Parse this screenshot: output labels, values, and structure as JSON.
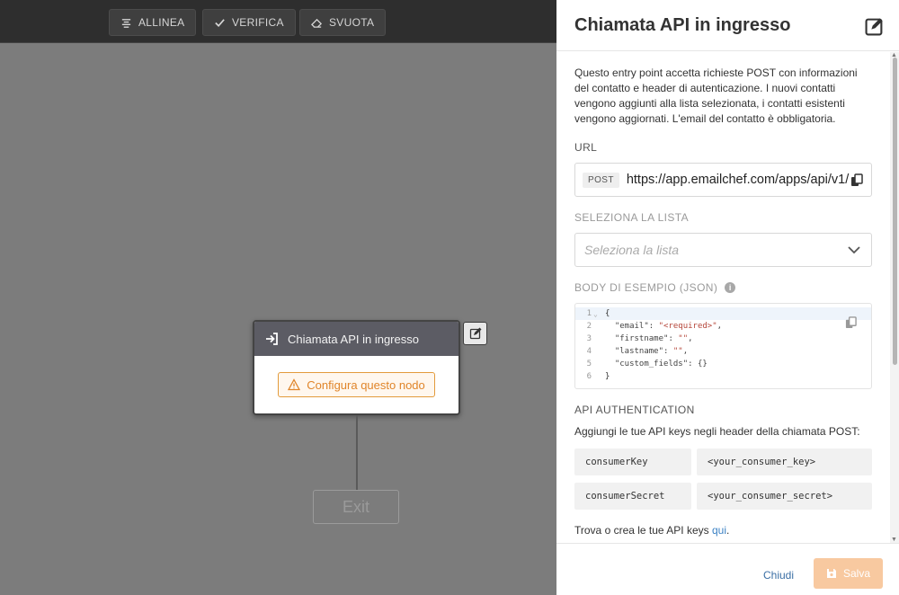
{
  "toolbar": {
    "align_label": "ALLINEA",
    "verify_label": "VERIFICA",
    "clear_label": "SVUOTA"
  },
  "node": {
    "title": "Chiamata API in ingresso",
    "configure_label": "Configura questo nodo"
  },
  "exit_node": {
    "label": "Exit"
  },
  "panel": {
    "title": "Chiamata API in ingresso",
    "description": "Questo entry point accetta richieste POST con informazioni del contatto e header di autenticazione. I nuovi contatti vengono aggiunti alla lista selezionata, i contatti esistenti vengono aggiornati. L'email del contatto è obbligatoria.",
    "url_label": "URL",
    "url_method": "POST",
    "url_value": "https://app.emailchef.com/apps/api/v1/",
    "list_label": "SELEZIONA LA LISTA",
    "list_placeholder": "Seleziona la lista",
    "body_label": "BODY DI ESEMPIO (JSON)",
    "body_info": "i",
    "code_lines": [
      {
        "n": "1",
        "text": "{"
      },
      {
        "n": "2",
        "key": "  \"email\": ",
        "val": "\"<required>\"",
        "end": ","
      },
      {
        "n": "3",
        "key": "  \"firstname\": ",
        "val": "\"\"",
        "end": ","
      },
      {
        "n": "4",
        "key": "  \"lastname\": ",
        "val": "\"\"",
        "end": ","
      },
      {
        "n": "5",
        "key": "  \"custom_fields\": ",
        "val": "{}",
        "end": ""
      },
      {
        "n": "6",
        "text": "}"
      }
    ],
    "auth_label": "API AUTHENTICATION",
    "auth_desc": "Aggiungi le tue API keys negli header della chiamata POST:",
    "headers": [
      {
        "key": "consumerKey",
        "value": "<your_consumer_key>"
      },
      {
        "key": "consumerSecret",
        "value": "<your_consumer_secret>"
      }
    ],
    "find_keys_text": "Trova o crea le tue API keys ",
    "find_keys_link": "qui",
    "find_keys_end": "."
  },
  "footer": {
    "close_label": "Chiudi",
    "save_label": "Salva"
  },
  "colors": {
    "accent_orange": "#e0852a",
    "save_button": "#f8c9a0",
    "link_blue": "#3c82c4"
  }
}
